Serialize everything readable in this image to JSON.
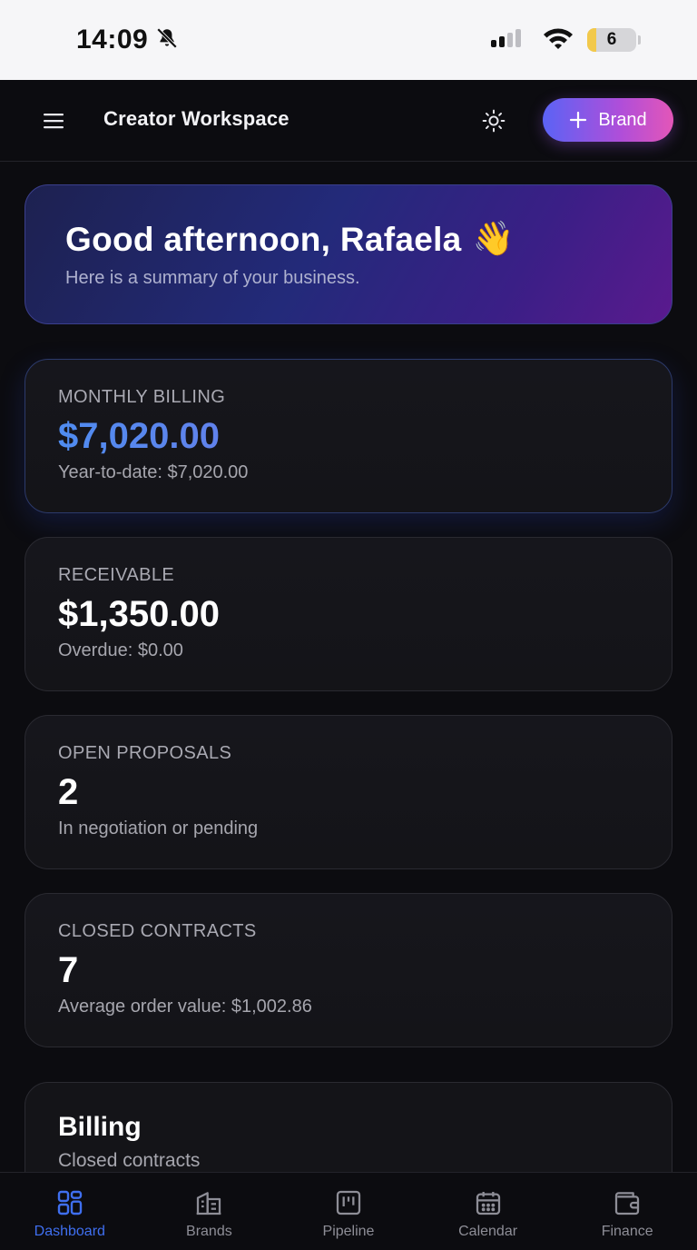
{
  "status_bar": {
    "time": "14:09",
    "battery_level": "6"
  },
  "header": {
    "title": "Creator Workspace",
    "add_brand_label": "Brand"
  },
  "greeting": {
    "title": "Good afternoon, Rafaela",
    "emoji": "👋",
    "subtitle": "Here is a summary of your business."
  },
  "stats": [
    {
      "label": "MONTHLY BILLING",
      "value": "$7,020.00",
      "sub": "Year-to-date: $7,020.00"
    },
    {
      "label": "RECEIVABLE",
      "value": "$1,350.00",
      "sub": "Overdue: $0.00"
    },
    {
      "label": "OPEN PROPOSALS",
      "value": "2",
      "sub": "In negotiation or pending"
    },
    {
      "label": "CLOSED CONTRACTS",
      "value": "7",
      "sub": "Average order value: $1,002.86"
    }
  ],
  "billing_section": {
    "title": "Billing",
    "subtitle": "Closed contracts"
  },
  "bottom_nav": {
    "items": [
      {
        "label": "Dashboard",
        "icon": "dashboard-icon",
        "active": true
      },
      {
        "label": "Brands",
        "icon": "building-icon",
        "active": false
      },
      {
        "label": "Pipeline",
        "icon": "kanban-icon",
        "active": false
      },
      {
        "label": "Calendar",
        "icon": "calendar-icon",
        "active": false
      },
      {
        "label": "Finance",
        "icon": "wallet-icon",
        "active": false
      }
    ]
  },
  "colors": {
    "accent": "#3f6ff0",
    "brand_gradient_start": "#5b63f5",
    "brand_gradient_end": "#e356b8"
  }
}
